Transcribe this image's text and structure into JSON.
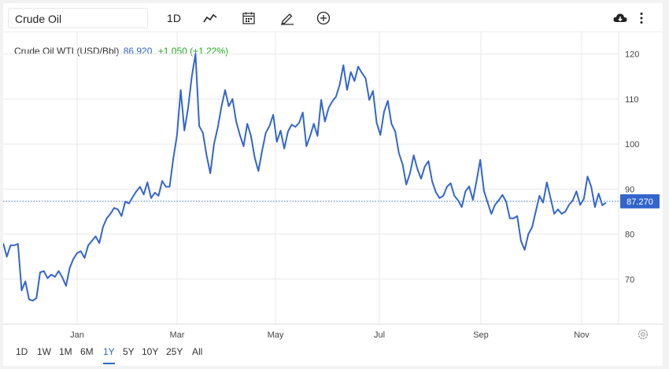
{
  "search": {
    "value": "Crude Oil"
  },
  "toolbar": {
    "interval_label": "1D",
    "icons": [
      "line-chart-icon",
      "calendar-icon",
      "pencil-icon",
      "plus-circle-icon",
      "cloud-download-icon",
      "more-vertical-icon"
    ]
  },
  "legend": {
    "name": "Crude Oil WTI (USD/Bbl)",
    "price": "86.920",
    "change": "+1.050 (+1.22%)"
  },
  "colors": {
    "line": "#3366cc",
    "positive": "#22aa22",
    "grid": "#e8e8e8",
    "current_badge": "#3366cc"
  },
  "chart_data": {
    "type": "line",
    "series": [
      {
        "values": [
          [
            0,
            78
          ],
          [
            1,
            75
          ],
          [
            2,
            77.5
          ],
          [
            3,
            77.5
          ],
          [
            4,
            77.8
          ],
          [
            5,
            67.5
          ],
          [
            6,
            69.5
          ],
          [
            7,
            65.5
          ],
          [
            8,
            65.2
          ],
          [
            9,
            65.8
          ],
          [
            10,
            71.5
          ],
          [
            11,
            71.8
          ],
          [
            12,
            70.2
          ],
          [
            13,
            71
          ],
          [
            14,
            70.5
          ],
          [
            15,
            71.8
          ],
          [
            16,
            70.4
          ],
          [
            17,
            68.5
          ],
          [
            18,
            72.5
          ],
          [
            19,
            74.5
          ],
          [
            20,
            75.8
          ],
          [
            21,
            76.2
          ],
          [
            22,
            74.7
          ],
          [
            23,
            77.5
          ],
          [
            24,
            78.5
          ],
          [
            25,
            79.5
          ],
          [
            26,
            78
          ],
          [
            27,
            81.6
          ],
          [
            28,
            83.5
          ],
          [
            29,
            84.5
          ],
          [
            30,
            85.8
          ],
          [
            31,
            85.5
          ],
          [
            32,
            84
          ],
          [
            33,
            87.2
          ],
          [
            34,
            86.8
          ],
          [
            35,
            88.2
          ],
          [
            36,
            89.5
          ],
          [
            37,
            90.5
          ],
          [
            38,
            88.8
          ],
          [
            39,
            91.5
          ],
          [
            40,
            88
          ],
          [
            41,
            89.2
          ],
          [
            42,
            88.5
          ],
          [
            43,
            91.8
          ],
          [
            44,
            90.5
          ],
          [
            45,
            90.5
          ],
          [
            46,
            96.8
          ],
          [
            47,
            102
          ],
          [
            48,
            112
          ],
          [
            49,
            103
          ],
          [
            50,
            108
          ],
          [
            51,
            115
          ],
          [
            52,
            120
          ],
          [
            53,
            104
          ],
          [
            54,
            102.5
          ],
          [
            55,
            97.5
          ],
          [
            56,
            93.5
          ],
          [
            57,
            100
          ],
          [
            58,
            103.6
          ],
          [
            59,
            108.2
          ],
          [
            60,
            112
          ],
          [
            61,
            108.4
          ],
          [
            62,
            110
          ],
          [
            63,
            105
          ],
          [
            64,
            102
          ],
          [
            65,
            99.5
          ],
          [
            66,
            104.5
          ],
          [
            67,
            101.8
          ],
          [
            68,
            97
          ],
          [
            69,
            94
          ],
          [
            70,
            98.5
          ],
          [
            71,
            102.5
          ],
          [
            72,
            104
          ],
          [
            73,
            106.5
          ],
          [
            74,
            100.5
          ],
          [
            75,
            103
          ],
          [
            76,
            99
          ],
          [
            77,
            102.8
          ],
          [
            78,
            104.3
          ],
          [
            79,
            103.8
          ],
          [
            80,
            104.7
          ],
          [
            81,
            107
          ],
          [
            82,
            99.5
          ],
          [
            83,
            101.8
          ],
          [
            84,
            104.5
          ],
          [
            85,
            101.8
          ],
          [
            86,
            109.8
          ],
          [
            87,
            105
          ],
          [
            88,
            108
          ],
          [
            89,
            109.5
          ],
          [
            90,
            110.5
          ],
          [
            91,
            113.2
          ],
          [
            92,
            117.5
          ],
          [
            93,
            112
          ],
          [
            94,
            116
          ],
          [
            95,
            114
          ],
          [
            96,
            117.2
          ],
          [
            97,
            115.8
          ],
          [
            98,
            114.6
          ],
          [
            99,
            109.8
          ],
          [
            100,
            111.8
          ],
          [
            101,
            104.7
          ],
          [
            102,
            102
          ],
          [
            103,
            107.2
          ],
          [
            104,
            109.6
          ],
          [
            105,
            104.5
          ],
          [
            106,
            102.8
          ],
          [
            107,
            98
          ],
          [
            108,
            95.5
          ],
          [
            109,
            91
          ],
          [
            110,
            93.5
          ],
          [
            111,
            97.5
          ],
          [
            112,
            94.5
          ],
          [
            113,
            92.3
          ],
          [
            114,
            95
          ],
          [
            115,
            96.2
          ],
          [
            116,
            91.7
          ],
          [
            117,
            89.3
          ],
          [
            118,
            88
          ],
          [
            119,
            88.5
          ],
          [
            120,
            90.5
          ],
          [
            121,
            91.3
          ],
          [
            122,
            88.5
          ],
          [
            123,
            87.5
          ],
          [
            124,
            86
          ],
          [
            125,
            89.5
          ],
          [
            126,
            90.6
          ],
          [
            127,
            87.6
          ],
          [
            128,
            91.8
          ],
          [
            129,
            96.5
          ],
          [
            130,
            89.6
          ],
          [
            131,
            87
          ],
          [
            132,
            84.5
          ],
          [
            133,
            86.5
          ],
          [
            134,
            87.5
          ],
          [
            135,
            88.7
          ],
          [
            136,
            87.2
          ],
          [
            137,
            83.5
          ],
          [
            138,
            83.5
          ],
          [
            139,
            84
          ],
          [
            140,
            78.5
          ],
          [
            141,
            76.5
          ],
          [
            142,
            80
          ],
          [
            143,
            81.5
          ],
          [
            144,
            85
          ],
          [
            145,
            88.5
          ],
          [
            146,
            87
          ],
          [
            147,
            91.5
          ],
          [
            148,
            88
          ],
          [
            149,
            84.5
          ],
          [
            150,
            85.5
          ],
          [
            151,
            84.5
          ],
          [
            152,
            85
          ],
          [
            153,
            86.5
          ],
          [
            154,
            87.5
          ],
          [
            155,
            89.5
          ],
          [
            156,
            86.5
          ],
          [
            157,
            87.8
          ],
          [
            158,
            92.8
          ],
          [
            159,
            90.5
          ],
          [
            160,
            86
          ],
          [
            161,
            89
          ],
          [
            162,
            86.4
          ],
          [
            163,
            87
          ]
        ]
      }
    ],
    "xlim": [
      0,
      163
    ],
    "x_tick_labels": [
      {
        "label": "Jan",
        "x": 18
      },
      {
        "label": "Mar",
        "x": 52
      },
      {
        "label": "May",
        "x": 86
      },
      {
        "label": "Jul",
        "x": 120
      },
      {
        "label": "Sep",
        "x": 154.5
      },
      {
        "label": "Nov",
        "x": 188
      }
    ],
    "y_ticks": [
      70,
      80,
      90,
      100,
      110,
      120
    ],
    "ylim": [
      60,
      125
    ],
    "current_value": 87.27,
    "current_label": "87.270",
    "grid": true
  },
  "range_buttons": [
    "1D",
    "1W",
    "1M",
    "6M",
    "1Y",
    "5Y",
    "10Y",
    "25Y",
    "All"
  ],
  "active_range": "1Y"
}
